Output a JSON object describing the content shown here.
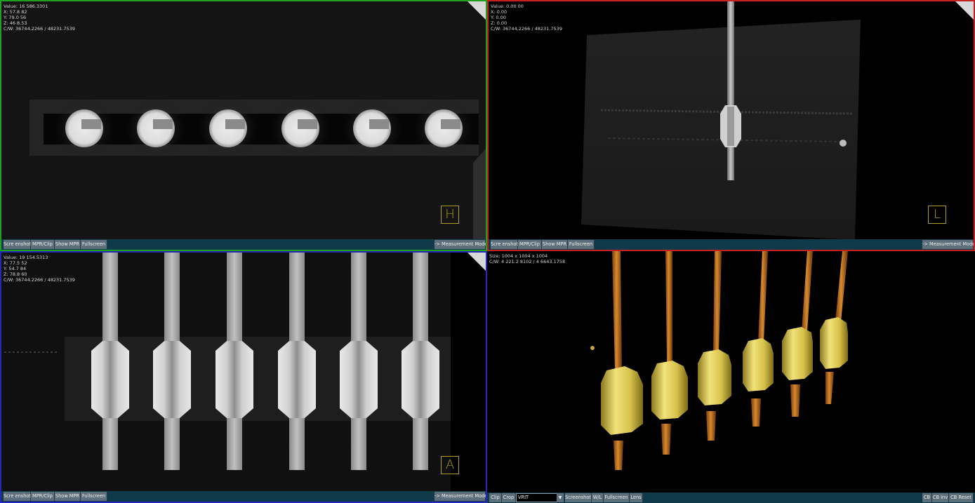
{
  "viewports": {
    "top_left": {
      "info": [
        "Value: 16 586.3301",
        "X: 57.8 82",
        "Y: 79.0 56",
        "Z: 46 8.53",
        "C/W: 36744.2266 / 48231.7539"
      ],
      "orientation": "H"
    },
    "top_right": {
      "info": [
        "Value: 0.00 00",
        "X: 0.00",
        "Y: 0.00",
        "Z: 0.00",
        "C/W: 36744.2266 / 48231.7539"
      ],
      "orientation": "L"
    },
    "bottom_left": {
      "info": [
        "Value: 19 154.5313",
        "X: 77.5 52",
        "Y: 54.7 84",
        "Z: 78.8 60",
        "C/W: 36744.2266 / 48231.7539"
      ],
      "orientation": "A"
    },
    "bottom_right": {
      "info": [
        "Size: 1004 x 1004 x 1004",
        "C/W: 4 221.2 8102 / 4 6643.1758"
      ]
    }
  },
  "mpr_toolbar": {
    "screenshot": "Scre enshot",
    "mpr_clip": "MPR/Clip",
    "show_mpr": "Show MPR",
    "fullscreen": "Fullscreen",
    "measurement_mode": "-> Measurement Mode"
  },
  "vr_toolbar": {
    "clip": "Clip",
    "crop": "Crop",
    "render_mode_value": "VRIT",
    "screenshot": "Screenshot",
    "wl": "W/L",
    "fullscreen": "Fullscreen",
    "lens": "Lens",
    "cb": "CB",
    "cb_inv": "CB Inv",
    "cb_reset": "CB Reset"
  },
  "colors": {
    "axial_border": "#1ea21e",
    "sagittal_border": "#c42020",
    "coronal_border": "#2626b8",
    "toolbar_bg": "#0e3a4a",
    "button_bg": "#5d6f7a",
    "orientation_marker": "#b09a2a",
    "render_gold": "#d9c64a",
    "render_copper": "#b5651d"
  },
  "icons": {
    "corner_fold": "page-fold-icon",
    "dropdown": "chevron-down-icon"
  }
}
